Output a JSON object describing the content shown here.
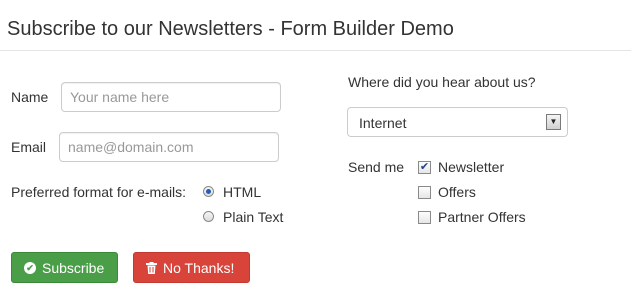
{
  "header": {
    "title": "Subscribe to our Newsletters - Form Builder Demo"
  },
  "form": {
    "name": {
      "label": "Name",
      "placeholder": "Your name here",
      "value": ""
    },
    "email": {
      "label": "Email",
      "placeholder": "name@domain.com",
      "value": ""
    },
    "format": {
      "label": "Preferred format for e-mails:",
      "options": [
        {
          "label": "HTML",
          "selected": true
        },
        {
          "label": "Plain Text",
          "selected": false
        }
      ]
    },
    "source": {
      "label": "Where did you hear about us?",
      "selected": "Internet"
    },
    "send": {
      "label": "Send me",
      "options": [
        {
          "label": "Newsletter",
          "checked": true
        },
        {
          "label": "Offers",
          "checked": false
        },
        {
          "label": "Partner Offers",
          "checked": false
        }
      ]
    }
  },
  "buttons": {
    "subscribe": {
      "label": "Subscribe",
      "icon": "ok-circle-icon",
      "color": "#4a9e48"
    },
    "decline": {
      "label": "No Thanks!",
      "icon": "trash-icon",
      "color": "#d9443a"
    }
  }
}
